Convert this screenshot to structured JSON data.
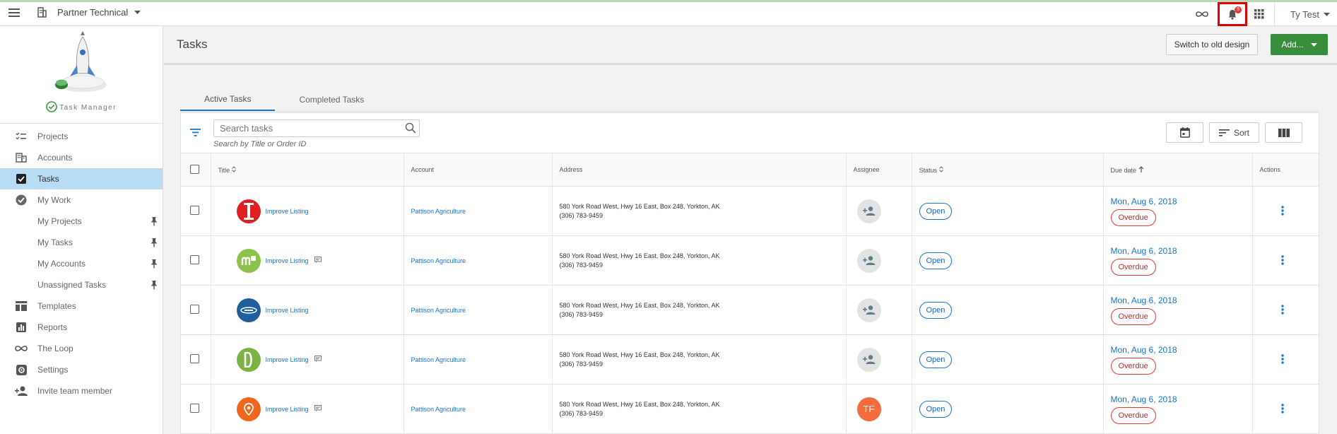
{
  "topbar": {
    "org_name": "Partner Technical",
    "notification_count": "9",
    "user_name": "Ty Test"
  },
  "sidebar": {
    "logo_caption": "Task Manager",
    "items": [
      {
        "label": "Projects",
        "icon": "checklist-icon"
      },
      {
        "label": "Accounts",
        "icon": "building-icon"
      },
      {
        "label": "Tasks",
        "icon": "checkbox-icon",
        "active": true
      },
      {
        "label": "My Work",
        "icon": "check-circle-icon"
      },
      {
        "label": "My Projects",
        "sub": true,
        "pinned": true
      },
      {
        "label": "My Tasks",
        "sub": true,
        "pinned": true
      },
      {
        "label": "My Accounts",
        "sub": true,
        "pinned": true
      },
      {
        "label": "Unassigned Tasks",
        "sub": true,
        "pinned": true
      },
      {
        "label": "Templates",
        "icon": "template-icon"
      },
      {
        "label": "Reports",
        "icon": "reports-icon"
      },
      {
        "label": "The Loop",
        "icon": "loop-icon"
      },
      {
        "label": "Settings",
        "icon": "settings-icon"
      },
      {
        "label": "Invite team member",
        "icon": "invite-icon"
      }
    ]
  },
  "header": {
    "title": "Tasks",
    "switch_label": "Switch to old design",
    "add_label": "Add..."
  },
  "tabs": [
    "Active Tasks",
    "Completed Tasks"
  ],
  "search": {
    "placeholder": "Search tasks",
    "hint": "Search by Title or Order ID"
  },
  "toolbar": {
    "sort_label": "Sort"
  },
  "table": {
    "columns": [
      "Title",
      "Account",
      "Address",
      "Assignee",
      "Status",
      "Due date",
      "Actions"
    ],
    "rows": [
      {
        "logo": "red",
        "title": "Improve Listing",
        "note": false,
        "account": "Pattison Agriculture",
        "address1": "580 York Road West, Hwy 16 East, Box 248, Yorkton, AK",
        "address2": "(306) 783-9459",
        "assignee": "",
        "status": "Open",
        "due": "Mon, Aug 6, 2018",
        "due_status": "Overdue"
      },
      {
        "logo": "green",
        "title": "Improve Listing",
        "note": true,
        "account": "Pattison Agriculture",
        "address1": "580 York Road West, Hwy 16 East, Box 248, Yorkton, AK",
        "address2": "(306) 783-9459",
        "assignee": "",
        "status": "Open",
        "due": "Mon, Aug 6, 2018",
        "due_status": "Overdue"
      },
      {
        "logo": "blue",
        "title": "Improve Listing",
        "note": false,
        "account": "Pattison Agriculture",
        "address1": "580 York Road West, Hwy 16 East, Box 248, Yorkton, AK",
        "address2": "(306) 783-9459",
        "assignee": "",
        "status": "Open",
        "due": "Mon, Aug 6, 2018",
        "due_status": "Overdue"
      },
      {
        "logo": "lime",
        "title": "Improve Listing",
        "note": true,
        "account": "Pattison Agriculture",
        "address1": "580 York Road West, Hwy 16 East, Box 248, Yorkton, AK",
        "address2": "(306) 783-9459",
        "assignee": "",
        "status": "Open",
        "due": "Mon, Aug 6, 2018",
        "due_status": "Overdue"
      },
      {
        "logo": "orange",
        "title": "Improve Listing",
        "note": true,
        "account": "Pattison Agriculture",
        "address1": "580 York Road West, Hwy 16 East, Box 248, Yorkton, AK",
        "address2": "(306) 783-9459",
        "assignee": "TF",
        "status": "Open",
        "due": "Mon, Aug 6, 2018",
        "due_status": "Overdue"
      }
    ]
  },
  "colors": {
    "primary": "#1976d2",
    "add_button": "#388e3c",
    "overdue": "#e53935",
    "active_nav": "#b9dcf5"
  }
}
